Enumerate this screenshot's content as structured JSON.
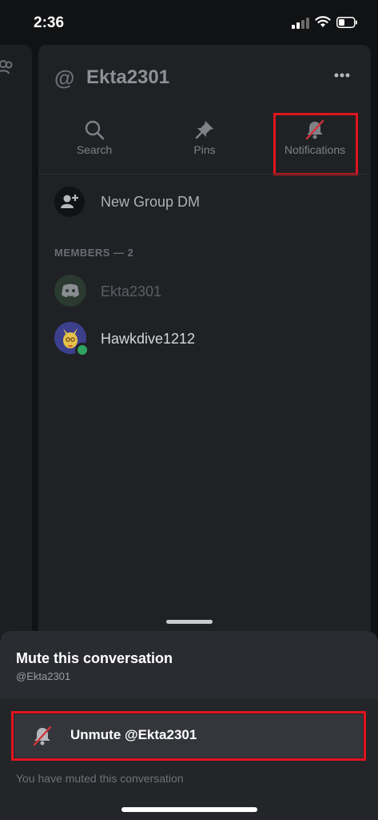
{
  "status_bar": {
    "time": "2:36"
  },
  "header": {
    "at_symbol": "@",
    "title": "Ekta2301"
  },
  "tabs": [
    {
      "label": "Search",
      "icon": "search-icon"
    },
    {
      "label": "Pins",
      "icon": "pin-icon"
    },
    {
      "label": "Notifications",
      "icon": "bell-muted-icon"
    }
  ],
  "new_group": {
    "label": "New Group DM",
    "icon": "add-user-icon"
  },
  "members": {
    "header": "MEMBERS — 2",
    "items": [
      {
        "name": "Ekta2301",
        "avatar": "discord-logo-avatar",
        "color": "#5c5e64"
      },
      {
        "name": "Hawkdive1212",
        "avatar": "fox-avatar",
        "color": "#d6d7da",
        "online": true
      }
    ]
  },
  "sheet": {
    "title": "Mute this conversation",
    "subtitle": "@Ekta2301",
    "unmute_label": "Unmute @Ekta2301",
    "note": "You have muted this conversation"
  },
  "colors": {
    "highlight": "#e1141e",
    "muted_slash": "#d1343b",
    "online": "#2ea35f"
  }
}
